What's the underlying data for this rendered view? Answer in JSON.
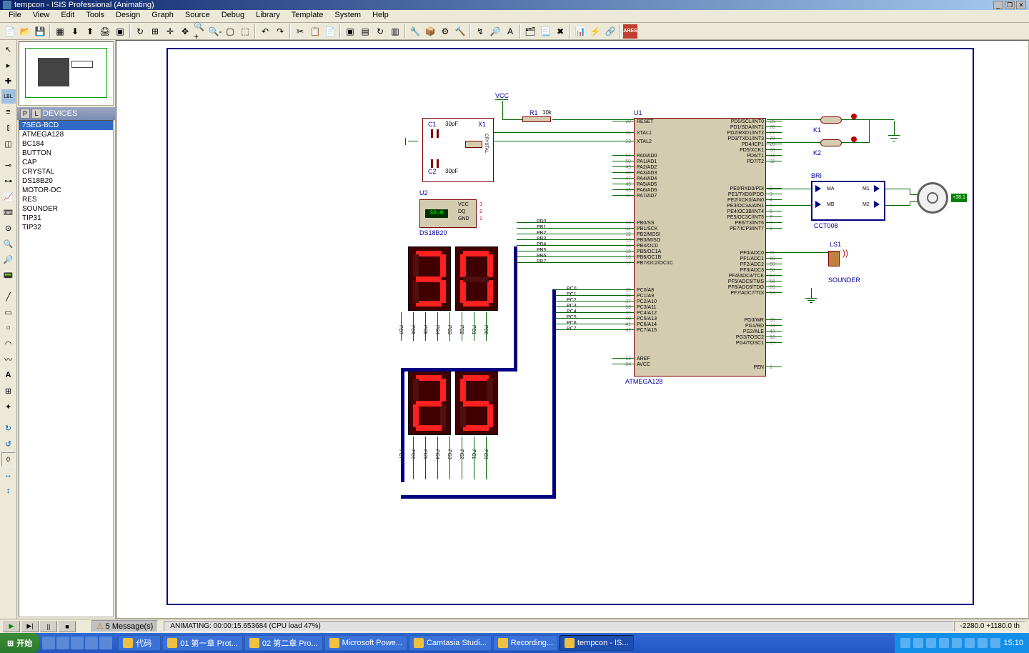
{
  "title": "tempcon - ISIS Professional (Animating)",
  "menu": [
    "File",
    "View",
    "Edit",
    "Tools",
    "Design",
    "Graph",
    "Source",
    "Debug",
    "Library",
    "Template",
    "System",
    "Help"
  ],
  "devices_header": "DEVICES",
  "devices": [
    "7SEG-BCD",
    "ATMEGA128",
    "BC184",
    "BUTTON",
    "CAP",
    "CRYSTAL",
    "DS18B20",
    "MOTOR-DC",
    "RES",
    "SOUNDER",
    "TIP31",
    "TIP32"
  ],
  "devices_selected": 0,
  "schematic": {
    "vcc": "VCC",
    "c1": {
      "ref": "C1",
      "val": "30pF"
    },
    "c2": {
      "ref": "C2",
      "val": "30pF"
    },
    "x1": {
      "ref": "X1",
      "val": "CRYSTAL"
    },
    "r1": {
      "ref": "R1",
      "val": "10k"
    },
    "u1": {
      "ref": "U1",
      "part": "ATMEGA128"
    },
    "u2": {
      "ref": "U2",
      "part": "DS18B20",
      "pins": [
        "VCC",
        "DQ",
        "GND"
      ],
      "reading": "30.0"
    },
    "bri": {
      "ref": "BRI",
      "part": "CCT008",
      "ma": "MA",
      "mb": "MB",
      "m1": "M1",
      "m2": "M2"
    },
    "k1": "K1",
    "k2": "K2",
    "ls1": {
      "ref": "LS1",
      "part": "SOUNDER"
    },
    "motor_rpm": "+38.1",
    "seg_top": "30",
    "seg_bot": "25",
    "pb_labels": [
      "PB7",
      "PB6",
      "PB5",
      "PB4",
      "PB3",
      "PB2",
      "PB1",
      "PB0"
    ],
    "pc_labels": [
      "PC7",
      "PC6",
      "PC5",
      "PC4",
      "PC3",
      "PC2",
      "PC1",
      "PC0"
    ],
    "mcu_left": [
      {
        "n": "20",
        "t": "RESET"
      },
      {
        "n": "24",
        "t": "XTAL1"
      },
      {
        "n": "23",
        "t": "XTAL2"
      },
      {
        "n": "51",
        "t": "PA0/AD0"
      },
      {
        "n": "50",
        "t": "PA1/AD1"
      },
      {
        "n": "49",
        "t": "PA2/AD2"
      },
      {
        "n": "48",
        "t": "PA3/AD3"
      },
      {
        "n": "47",
        "t": "PA4/AD4"
      },
      {
        "n": "46",
        "t": "PA5/AD5"
      },
      {
        "n": "45",
        "t": "PA6/AD6"
      },
      {
        "n": "44",
        "t": "PA7/AD7"
      },
      {
        "n": "10",
        "t": "PB0/SS"
      },
      {
        "n": "11",
        "t": "PB1/SCK"
      },
      {
        "n": "12",
        "t": "PB2/MOSI"
      },
      {
        "n": "13",
        "t": "PB3/MISO"
      },
      {
        "n": "14",
        "t": "PB4/OC0"
      },
      {
        "n": "15",
        "t": "PB5/OC1A"
      },
      {
        "n": "16",
        "t": "PB6/OC1B"
      },
      {
        "n": "17",
        "t": "PB7/OC2/OC1C"
      },
      {
        "n": "35",
        "t": "PC0/A8"
      },
      {
        "n": "36",
        "t": "PC1/A9"
      },
      {
        "n": "37",
        "t": "PC2/A10"
      },
      {
        "n": "38",
        "t": "PC3/A11"
      },
      {
        "n": "39",
        "t": "PC4/A12"
      },
      {
        "n": "40",
        "t": "PC5/A13"
      },
      {
        "n": "41",
        "t": "PC6/A14"
      },
      {
        "n": "42",
        "t": "PC7/A15"
      },
      {
        "n": "62",
        "t": "AREF"
      },
      {
        "n": "64",
        "t": "AVCC"
      }
    ],
    "mcu_right": [
      {
        "n": "25",
        "t": "PD0/SCL/INT0"
      },
      {
        "n": "26",
        "t": "PD1/SDA/INT1"
      },
      {
        "n": "27",
        "t": "PD2/RXD1/INT2"
      },
      {
        "n": "28",
        "t": "PD3/TXD1/INT3"
      },
      {
        "n": "29",
        "t": "PD4/ICP1"
      },
      {
        "n": "30",
        "t": "PD5/XCK1"
      },
      {
        "n": "31",
        "t": "PD6/T1"
      },
      {
        "n": "32",
        "t": "PD7/T2"
      },
      {
        "n": "2",
        "t": "PE0/RXD0/PDI"
      },
      {
        "n": "3",
        "t": "PE1/TXD0/PDO"
      },
      {
        "n": "4",
        "t": "PE2/XCK0/AIN0"
      },
      {
        "n": "5",
        "t": "PE3/OC3A/AIN1"
      },
      {
        "n": "6",
        "t": "PE4/OC3B/INT4"
      },
      {
        "n": "7",
        "t": "PE5/OC3C/INT5"
      },
      {
        "n": "8",
        "t": "PE6/T3/INT6"
      },
      {
        "n": "9",
        "t": "PE7/ICP3/INT7"
      },
      {
        "n": "61",
        "t": "PF0/ADC0"
      },
      {
        "n": "60",
        "t": "PF1/ADC1"
      },
      {
        "n": "59",
        "t": "PF2/ADC2"
      },
      {
        "n": "58",
        "t": "PF3/ADC3"
      },
      {
        "n": "57",
        "t": "PF4/ADC4/TCK"
      },
      {
        "n": "56",
        "t": "PF5/ADC5/TMS"
      },
      {
        "n": "55",
        "t": "PF6/ADC6/TDO"
      },
      {
        "n": "54",
        "t": "PF7/ADC7/TDI"
      },
      {
        "n": "33",
        "t": "PG0/WR"
      },
      {
        "n": "34",
        "t": "PG1/RD"
      },
      {
        "n": "43",
        "t": "PG2/ALE"
      },
      {
        "n": "18",
        "t": "PG3/TOSC2"
      },
      {
        "n": "19",
        "t": "PG4/TOSC1"
      },
      {
        "n": "1",
        "t": "PEN"
      }
    ],
    "pb_bus": [
      "PB0",
      "PB1",
      "PB2",
      "PB3",
      "PB4",
      "PB5",
      "PB6",
      "PB7"
    ],
    "pc_bus": [
      "PC0",
      "PC1",
      "PC2",
      "PC3",
      "PC4",
      "PC5",
      "PC6",
      "PC7"
    ]
  },
  "sim": {
    "messages": "5 Message(s)",
    "status": "ANIMATING: 00:00:15.653684 (CPU load 47%)",
    "coords": "-2280.0   +1180.0   th"
  },
  "taskbar": {
    "start": "开始",
    "tasks": [
      {
        "icon": "folder",
        "label": "代码"
      },
      {
        "icon": "word",
        "label": "01 第一章 Prot..."
      },
      {
        "icon": "word",
        "label": "02 第二章  Pro..."
      },
      {
        "icon": "ppt",
        "label": "Microsoft Powe..."
      },
      {
        "icon": "app",
        "label": "Camtasia Studi..."
      },
      {
        "icon": "rec",
        "label": "Recording..."
      },
      {
        "icon": "isis",
        "label": "tempcon - IS...",
        "active": true
      }
    ],
    "clock": "15:10"
  }
}
